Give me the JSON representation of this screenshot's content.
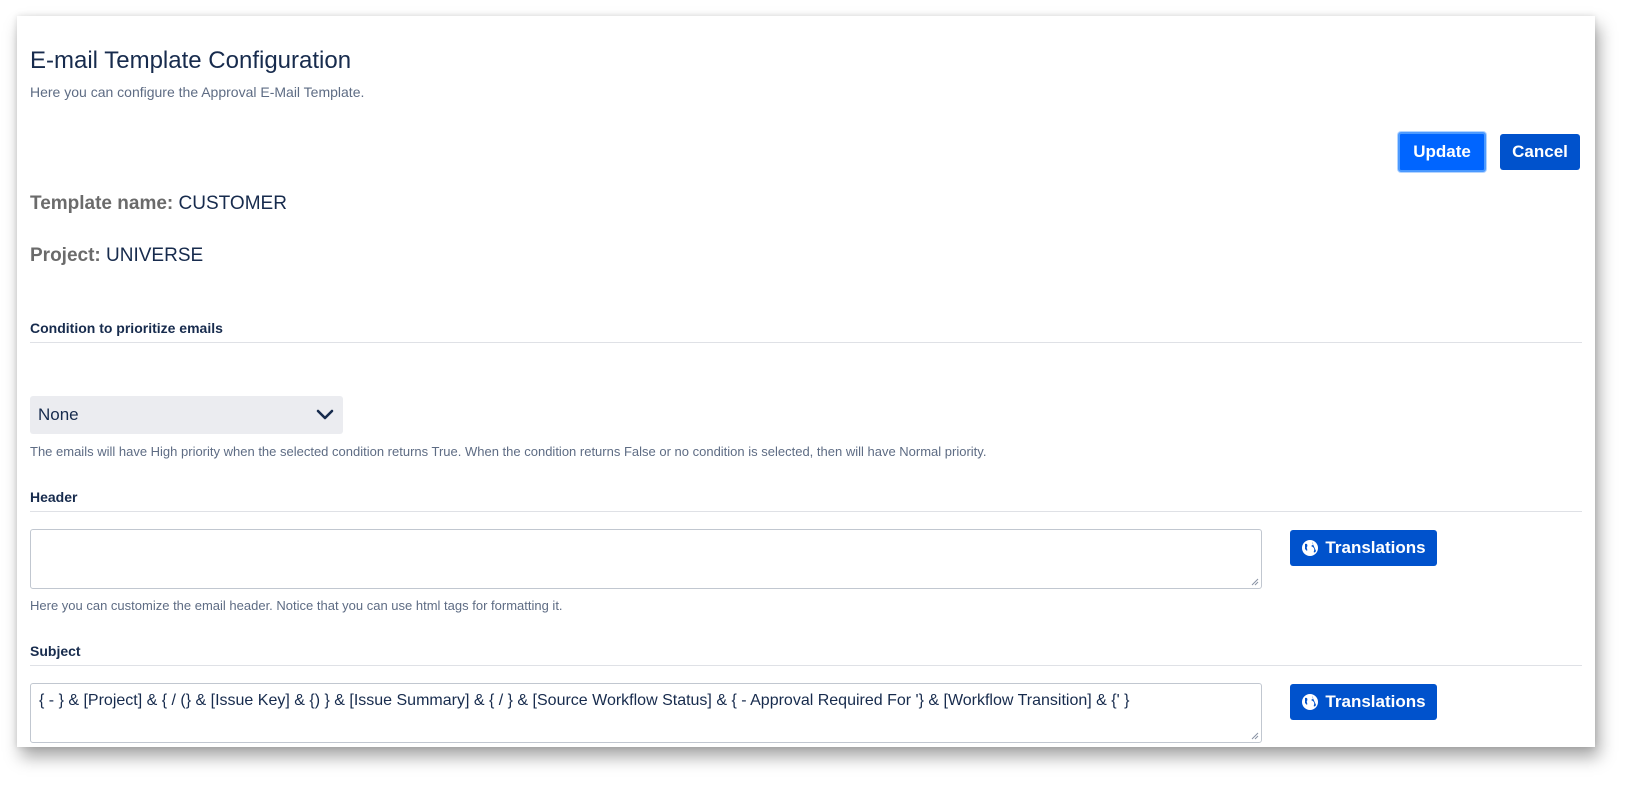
{
  "page": {
    "title": "E-mail Template Configuration",
    "subtitle": "Here you can configure the Approval E-Mail Template."
  },
  "actions": {
    "update_label": "Update",
    "cancel_label": "Cancel"
  },
  "template": {
    "name_label": "Template name:",
    "name_value": "CUSTOMER",
    "project_label": "Project:",
    "project_value": "UNIVERSE"
  },
  "condition": {
    "section_label": "Condition to prioritize emails",
    "selected": "None",
    "help": "The emails will have High priority when the selected condition returns True. When the condition returns False or no condition is selected, then will have Normal priority."
  },
  "header_section": {
    "section_label": "Header",
    "value": "",
    "help": "Here you can customize the email header. Notice that you can use html tags for formatting it.",
    "translations_label": "Translations"
  },
  "subject_section": {
    "section_label": "Subject",
    "value": "{ - } & [Project] & { / (} & [Issue Key] & {) } & [Issue Summary] & { / } & [Source Workflow Status] & { - Approval Required For '} & [Workflow Transition] & {' }",
    "translations_label": "Translations"
  },
  "colors": {
    "primary": "#0052cc",
    "primary_focused": "#0065ff",
    "text": "#172b4d",
    "muted": "#5e6c84"
  },
  "icons": {
    "select": "chevron-down-icon",
    "translations": "globe-icon"
  }
}
